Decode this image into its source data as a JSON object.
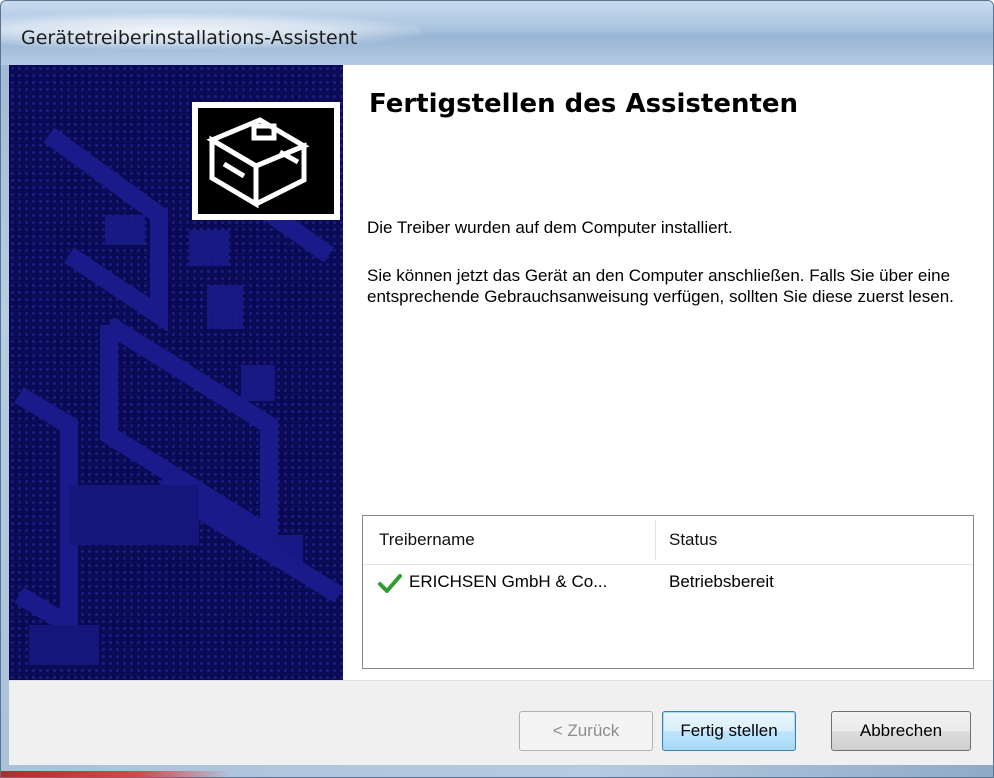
{
  "window": {
    "title": "Gerätetreiberinstallations-Assistent"
  },
  "page": {
    "heading": "Fertigstellen des Assistenten",
    "message1": "Die Treiber wurden auf dem Computer installiert.",
    "message2": "Sie können jetzt das Gerät an den Computer anschließen. Falls Sie über eine entsprechende Gebrauchsanweisung verfügen, sollten Sie diese zuerst lesen."
  },
  "driver_list": {
    "columns": {
      "name": "Treibername",
      "status": "Status"
    },
    "rows": [
      {
        "icon": "green-check-icon",
        "name": "ERICHSEN GmbH & Co...",
        "status": "Betriebsbereit"
      }
    ]
  },
  "buttons": {
    "back": "< Zurück",
    "finish": "Fertig stellen",
    "cancel": "Abbrechen"
  },
  "colors": {
    "banner": "#0b0b55",
    "banner_pattern": "#1a1a8a",
    "check": "#2e9e2e",
    "finish_focus": "#3c7fb1"
  }
}
